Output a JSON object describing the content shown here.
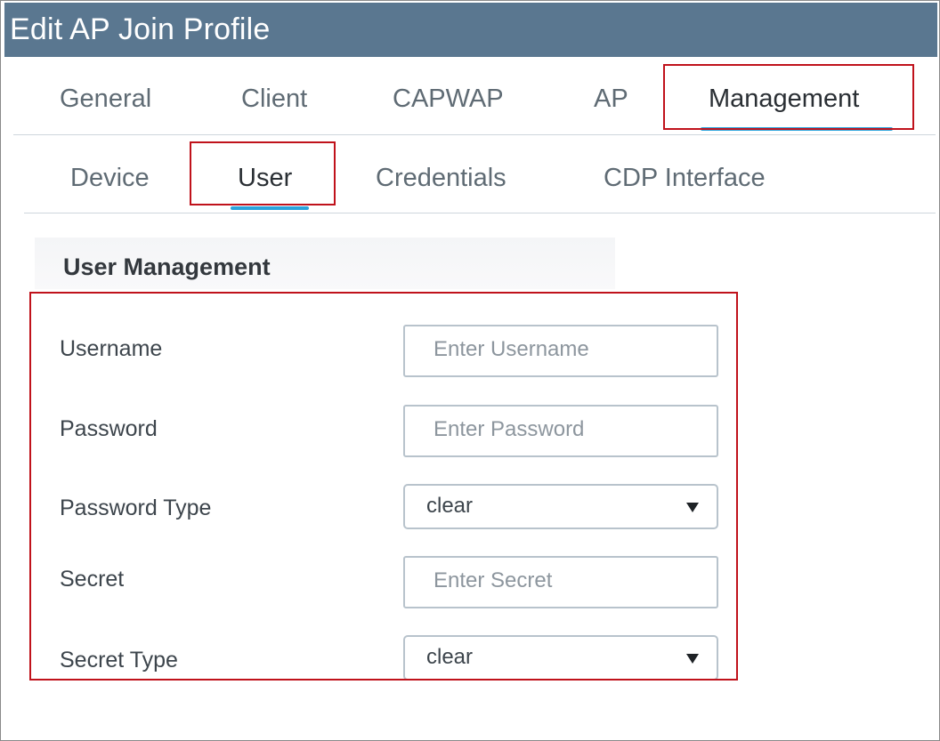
{
  "window": {
    "title": "Edit AP Join Profile"
  },
  "tabs": [
    {
      "label": "General"
    },
    {
      "label": "Client"
    },
    {
      "label": "CAPWAP"
    },
    {
      "label": "AP"
    },
    {
      "label": "Management",
      "active": true
    }
  ],
  "subtabs": [
    {
      "label": "Device"
    },
    {
      "label": "User",
      "active": true
    },
    {
      "label": "Credentials"
    },
    {
      "label": "CDP Interface"
    }
  ],
  "section": {
    "title": "User Management"
  },
  "fields": {
    "username": {
      "label": "Username",
      "placeholder": "Enter Username",
      "value": ""
    },
    "password": {
      "label": "Password",
      "placeholder": "Enter Password",
      "value": ""
    },
    "password_type": {
      "label": "Password Type",
      "value": "clear"
    },
    "secret": {
      "label": "Secret",
      "placeholder": "Enter Secret",
      "value": ""
    },
    "secret_type": {
      "label": "Secret Type",
      "value": "clear"
    }
  },
  "colors": {
    "titlebar": "#5a7790",
    "accent_underline": "#2aa3dc",
    "highlight_border": "#c0121b"
  }
}
